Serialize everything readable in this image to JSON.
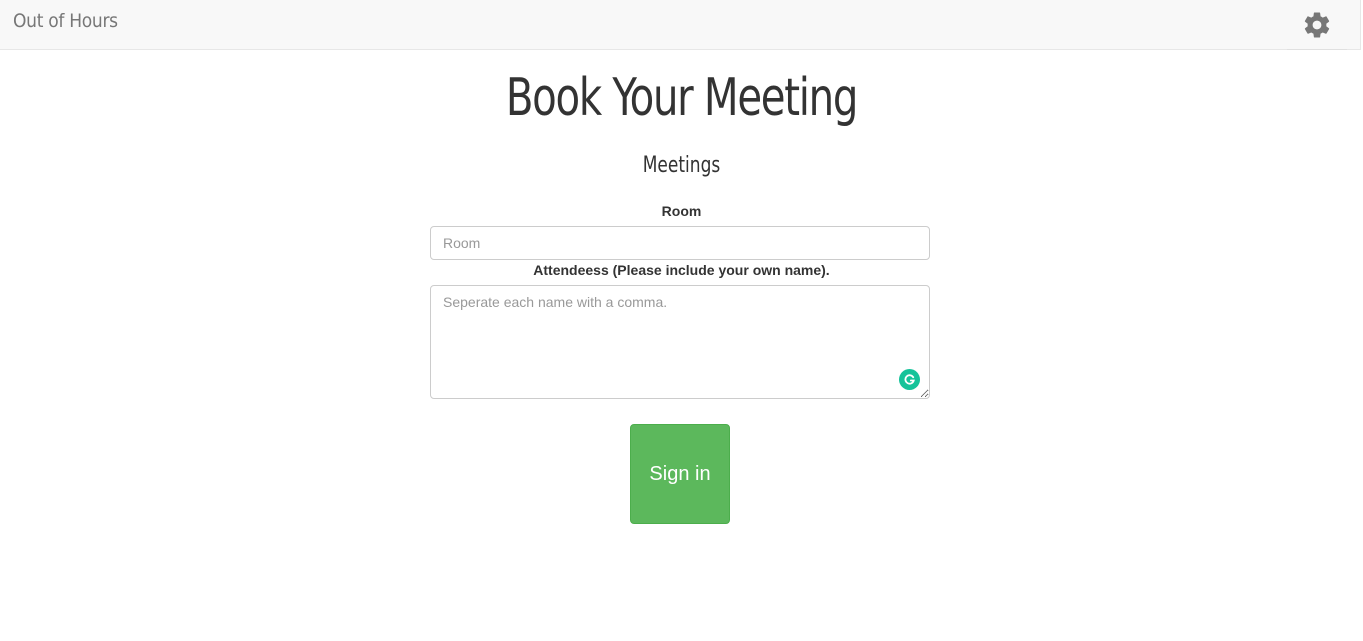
{
  "navbar": {
    "brand": "Out of Hours",
    "settings_icon": "gear-icon"
  },
  "main": {
    "title": "Book Your Meeting",
    "section_title": "Meetings",
    "form": {
      "room_label": "Room",
      "room_placeholder": "Room",
      "room_value": "",
      "attendees_label": "Attendeess (Please include your own name).",
      "attendees_placeholder": "Seperate each name with a comma.",
      "attendees_value": "",
      "grammar_badge_icon": "grammarly-icon",
      "submit_label": "Sign in"
    }
  },
  "colors": {
    "navbar_bg": "#f8f8f8",
    "brand_text": "#777777",
    "success_button": "#5cb85c",
    "grammarly_badge": "#15c39a"
  }
}
